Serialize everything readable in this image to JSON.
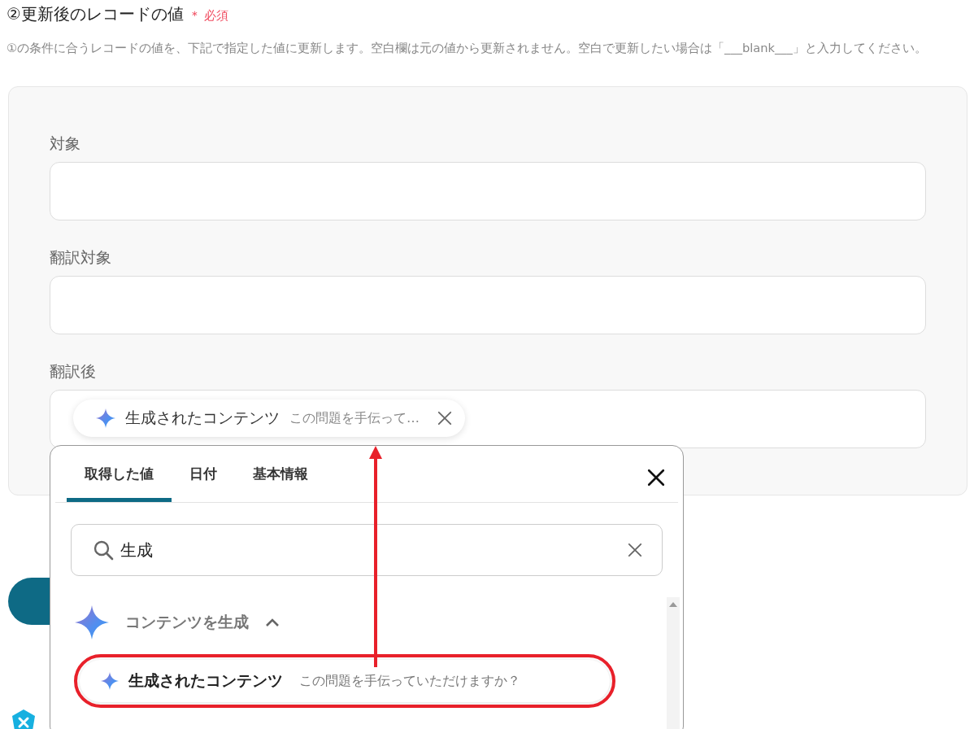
{
  "section": {
    "title": "②更新後のレコードの値",
    "required_mark": "＊",
    "required_label": "必須",
    "description": "①の条件に合うレコードの値を、下記で指定した値に更新します。空白欄は元の値から更新されません。空白で更新したい場合は「___blank___」と入力してください。"
  },
  "fields": [
    {
      "label": "対象"
    },
    {
      "label": "翻訳対象"
    },
    {
      "label": "翻訳後",
      "chip": {
        "name": "生成されたコンテンツ",
        "preview": "この問題を手伝って…"
      }
    }
  ],
  "picker": {
    "tabs": [
      {
        "label": "取得した値",
        "selected": true
      },
      {
        "label": "日付",
        "selected": false
      },
      {
        "label": "基本情報",
        "selected": false
      }
    ],
    "search": {
      "value": "生成"
    },
    "group": {
      "label": "コンテンツを生成",
      "expanded": true
    },
    "items": [
      {
        "name": "生成されたコンテンツ",
        "description": "この問題を手伝っていただけますか？",
        "highlighted": true
      }
    ]
  }
}
